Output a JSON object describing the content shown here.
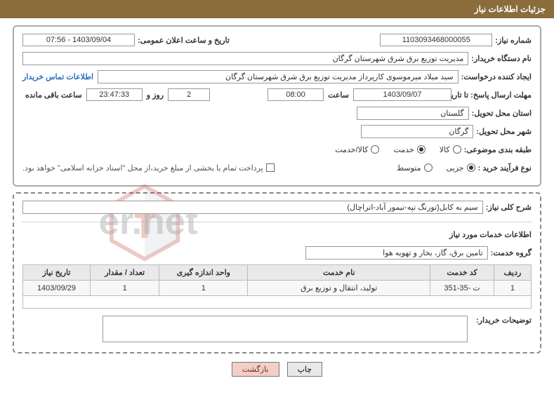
{
  "header": {
    "title": "جزئیات اطلاعات نیاز"
  },
  "info": {
    "requestNumberLabel": "شماره نیاز:",
    "requestNumber": "1103093468000055",
    "announceLabel": "تاریخ و ساعت اعلان عمومی:",
    "announceValue": "1403/09/04 - 07:56",
    "buyerDeviceLabel": "نام دستگاه خریدار:",
    "buyerDevice": "مدیریت توزیع برق شرق شهرستان گرگان",
    "requesterLabel": "ایجاد کننده درخواست:",
    "requester": "سید میلاد میرموسوی کارپرداز مدیریت توزیع برق شرق شهرستان گرگان",
    "buyerContactLink": "اطلاعات تماس خریدار",
    "deadlineLabel": "مهلت ارسال پاسخ: تا تاریخ:",
    "deadlineDate": "1403/09/07",
    "timeLabel": "ساعت",
    "deadlineTime": "08:00",
    "daysCount": "2",
    "daysSuffix": "روز و",
    "countdown": "23:47:33",
    "remainingSuffix": "ساعت باقی مانده",
    "provinceLabel": "استان محل تحویل:",
    "province": "گلستان",
    "cityLabel": "شهر محل تحویل:",
    "city": "گرگان",
    "subjectClassLabel": "طبقه بندی موضوعی:",
    "radioGoods": "کالا",
    "radioService": "خدمت",
    "radioBoth": "کالا/خدمت",
    "processTypeLabel": "نوع فرآیند خرید :",
    "radioPartial": "جزیی",
    "radioMedium": "متوسط",
    "paymentNote": "پرداخت تمام یا بخشی از مبلغ خرید،از محل \"اسناد خزانه اسلامی\" خواهد بود."
  },
  "need": {
    "generalDescLabel": "شرح کلی نیاز:",
    "generalDescValue": "سیم به کابل(تورنگ تپه-تیمور آباد-اتراچال)",
    "servicesInfoLabel": "اطلاعات خدمات مورد نیاز",
    "serviceGroupLabel": "گروه خدمت:",
    "serviceGroup": "تامین برق، گاز، بخار و تهویه هوا"
  },
  "table": {
    "headers": {
      "row": "ردیف",
      "code": "کد خدمت",
      "name": "نام خدمت",
      "unit": "واحد اندازه گیری",
      "qty": "تعداد / مقدار",
      "date": "تاریخ نیاز"
    },
    "rows": [
      {
        "row": "1",
        "code": "ت -35-351",
        "name": "تولید، انتقال و توزیع برق",
        "unit": "1",
        "qty": "1",
        "date": "1403/09/29"
      }
    ]
  },
  "buyerDesc": {
    "label": "توضیحات خریدار:"
  },
  "buttons": {
    "print": "چاپ",
    "back": "بازگشت"
  }
}
